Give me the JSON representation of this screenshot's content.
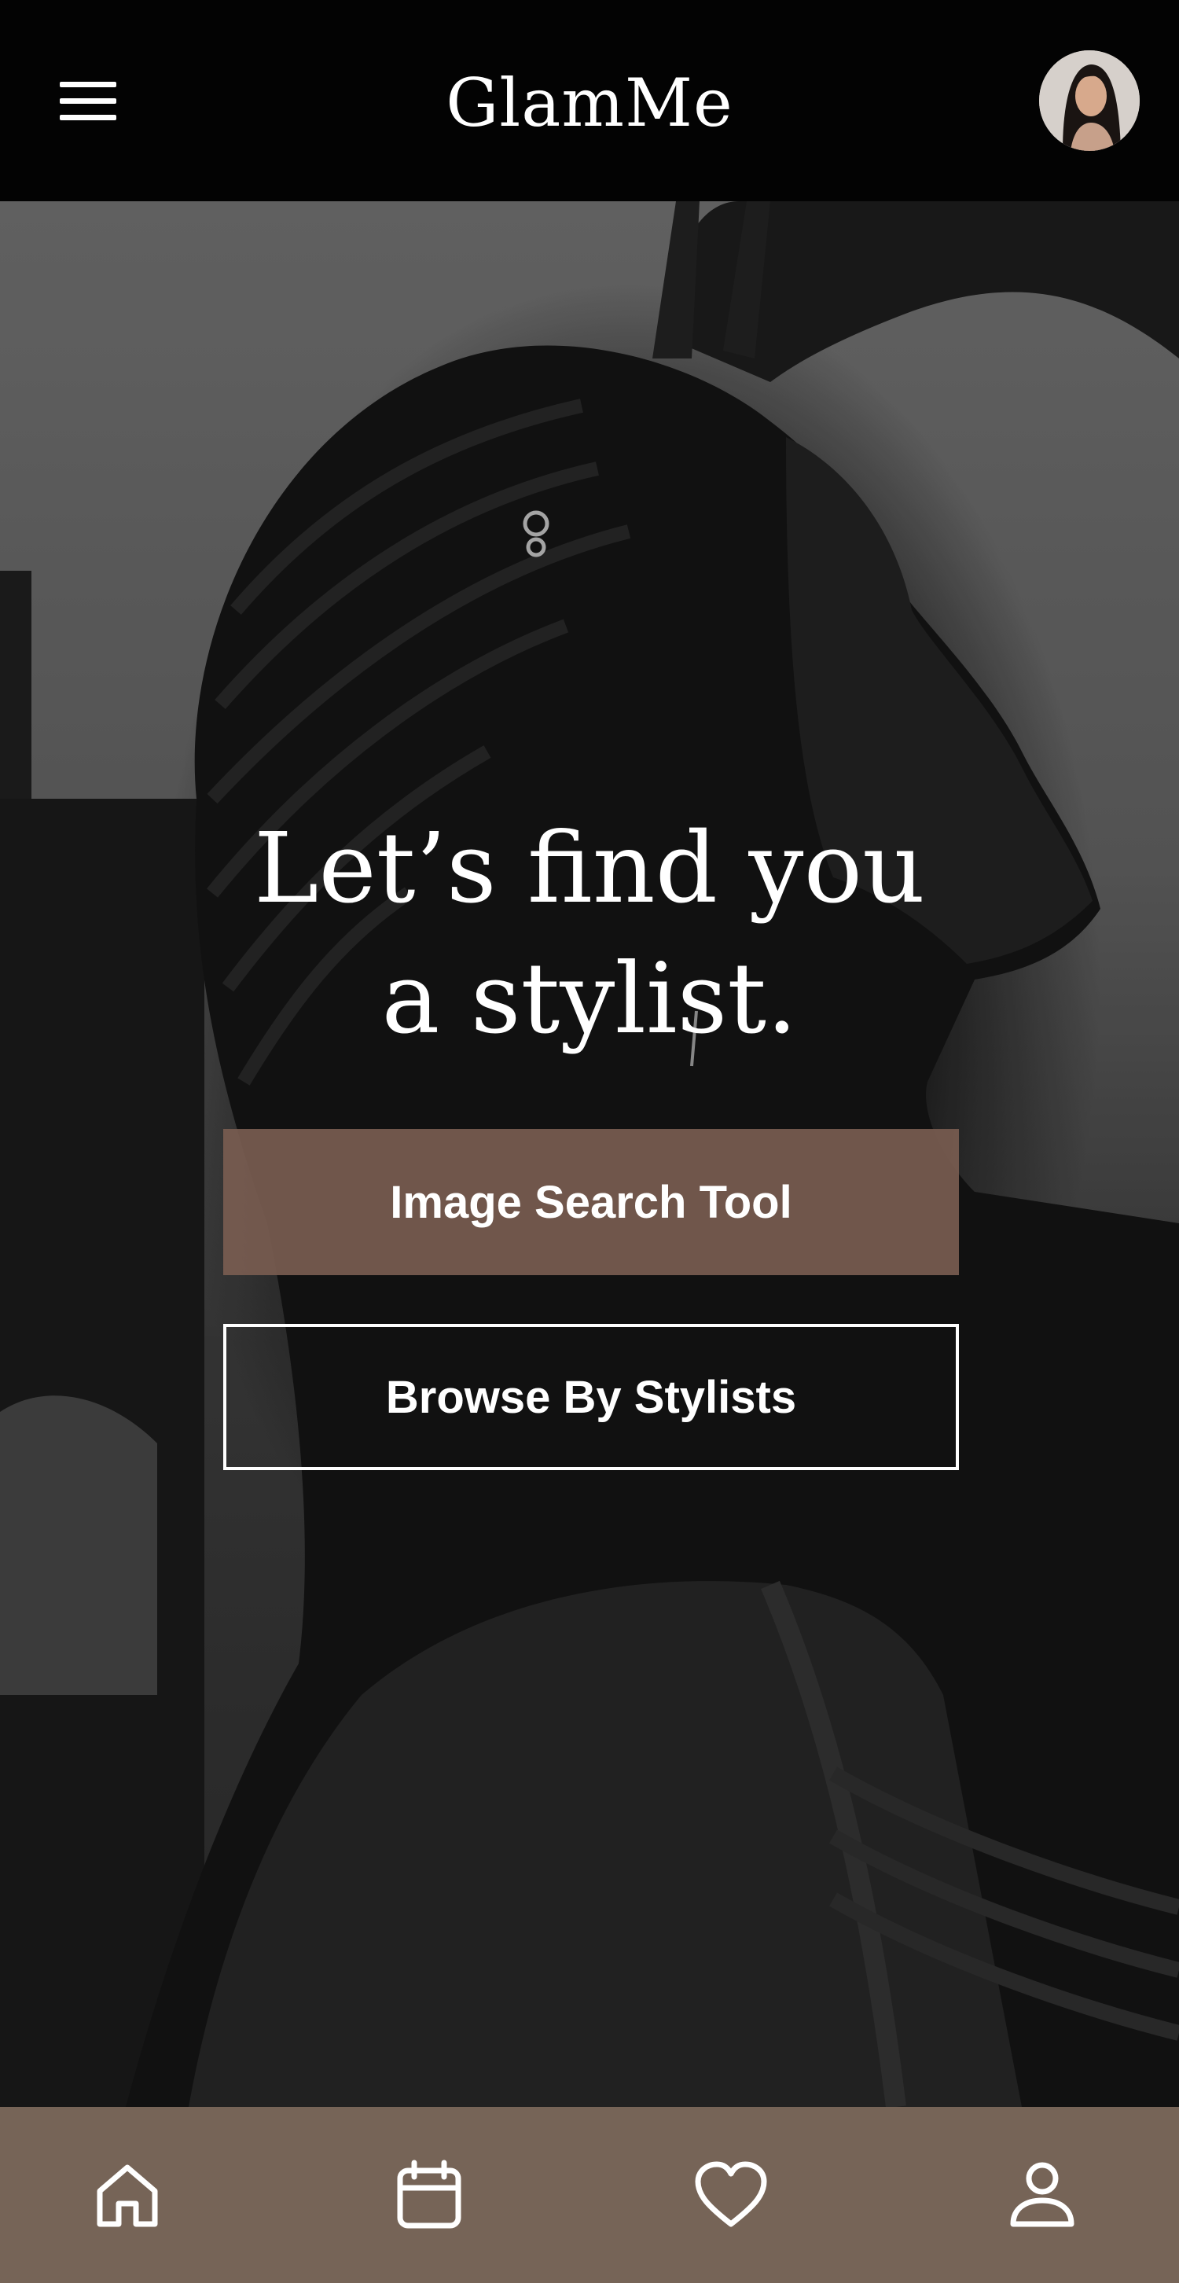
{
  "header": {
    "title": "GlamMe",
    "menu_icon": "hamburger-menu-icon",
    "avatar_icon": "user-avatar"
  },
  "hero": {
    "headline_line1": "Let’s find you",
    "headline_line2": "a stylist.",
    "primary_button": "Image Search Tool",
    "secondary_button": "Browse By Stylists"
  },
  "bottom_nav": {
    "items": [
      {
        "icon": "home-icon"
      },
      {
        "icon": "calendar-icon"
      },
      {
        "icon": "heart-icon"
      },
      {
        "icon": "profile-icon"
      }
    ]
  },
  "colors": {
    "header_bg": "#030303",
    "accent": "#785c50",
    "nav_bg": "#766457",
    "text": "#ffffff"
  }
}
